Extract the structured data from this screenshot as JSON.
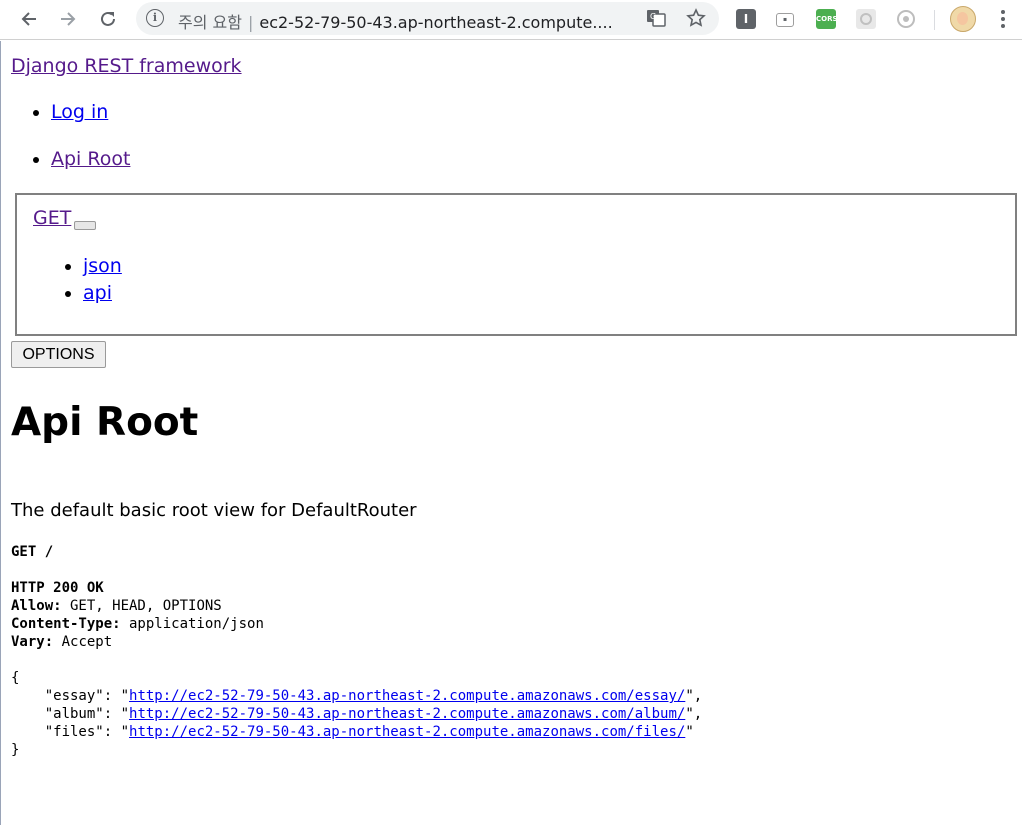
{
  "browser": {
    "url_warning": "주의 요함",
    "url_text": "ec2-52-79-50-43.ap-northeast-2.compute....",
    "back_icon": "arrow-left-icon",
    "forward_icon": "arrow-right-icon",
    "reload_icon": "reload-icon",
    "translate_icon": "translate-icon",
    "bookmark_icon": "star-icon",
    "extensions": [
      {
        "name": "extension-i-icon",
        "label": "I",
        "color": "#5f6368"
      },
      {
        "name": "extension-box-icon",
        "label": "",
        "color": "#9e9e9e"
      },
      {
        "name": "extension-cors-icon",
        "label": "CORS",
        "color": "#4caf50"
      },
      {
        "name": "extension-gear-icon",
        "label": "",
        "color": "#d0d0d0"
      },
      {
        "name": "extension-target-icon",
        "label": "",
        "color": "#bdbdbd"
      }
    ],
    "menu_icon": "kebab-menu-icon"
  },
  "navbar": {
    "brand": "Django REST framework",
    "items": [
      {
        "label": "Log in"
      },
      {
        "label": "Api Root"
      }
    ]
  },
  "request_form": {
    "method_link": "GET",
    "formats": [
      "json",
      "api"
    ]
  },
  "options_button": "OPTIONS",
  "content": {
    "title": "Api Root",
    "description": "The default basic root view for DefaultRouter",
    "request_line": "GET /",
    "status_line": "HTTP 200 OK",
    "headers": [
      {
        "name": "Allow:",
        "value": " GET, HEAD, OPTIONS"
      },
      {
        "name": "Content-Type:",
        "value": " application/json"
      },
      {
        "name": "Vary:",
        "value": " Accept"
      }
    ],
    "json_open": "{",
    "json_close": "}",
    "json_entries": [
      {
        "key": "    \"essay\": \"",
        "url": "http://ec2-52-79-50-43.ap-northeast-2.compute.amazonaws.com/essay/",
        "suffix": "\","
      },
      {
        "key": "    \"album\": \"",
        "url": "http://ec2-52-79-50-43.ap-northeast-2.compute.amazonaws.com/album/",
        "suffix": "\","
      },
      {
        "key": "    \"files\": \"",
        "url": "http://ec2-52-79-50-43.ap-northeast-2.compute.amazonaws.com/files/",
        "suffix": "\""
      }
    ]
  },
  "colors": {
    "link": "#0000ee",
    "visited_link": "#551a8b",
    "border": "#808080"
  }
}
